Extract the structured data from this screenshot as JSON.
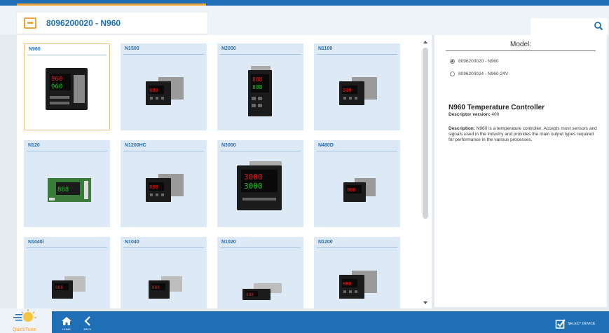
{
  "header": {
    "title": "8096200020 - N960",
    "search": {
      "placeholder": "",
      "icon": "search-icon"
    }
  },
  "devices": [
    {
      "label": "N960",
      "selected": true,
      "image": "controller-square-tall"
    },
    {
      "label": "N1500",
      "selected": false,
      "image": "controller-wide"
    },
    {
      "label": "N2000",
      "selected": false,
      "image": "controller-tall"
    },
    {
      "label": "N1100",
      "selected": false,
      "image": "controller-wide"
    },
    {
      "label": "N120",
      "selected": false,
      "image": "circuit-board"
    },
    {
      "label": "N1200HC",
      "selected": false,
      "image": "controller-wide"
    },
    {
      "label": "N3000",
      "selected": false,
      "image": "controller-square-large"
    },
    {
      "label": "N480D",
      "selected": false,
      "image": "controller-wide-small"
    },
    {
      "label": "N1040i",
      "selected": false,
      "image": "controller-din-small"
    },
    {
      "label": "N1040",
      "selected": false,
      "image": "controller-din-small"
    },
    {
      "label": "N1020",
      "selected": false,
      "image": "controller-flat"
    },
    {
      "label": "N1200",
      "selected": false,
      "image": "controller-wide"
    }
  ],
  "model": {
    "title": "Model:",
    "options": [
      {
        "label": "8096200020 - N960",
        "selected": true
      },
      {
        "label": "8096200024 - N960-24V",
        "selected": false
      }
    ]
  },
  "product": {
    "name": "N960 Temperature Controller",
    "descriptor_label": "Descriptor version:",
    "descriptor_version": "400",
    "description_label": "Description:",
    "description": "N960 is a temperature controller. Accepts most sensors and signals used in the industry and provides the main output types required for performance in the various processes."
  },
  "footer": {
    "logo_text": "QuickTune",
    "home_label": "HOME",
    "back_label": "BACK",
    "select_label": "SELECT DEVICE"
  },
  "colors": {
    "brand_blue": "#1f6fb7",
    "accent_orange": "#f0a43a"
  }
}
